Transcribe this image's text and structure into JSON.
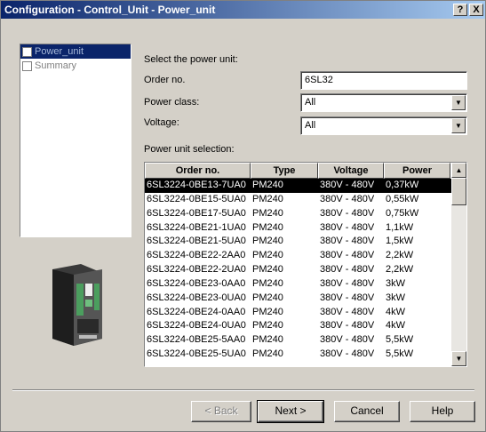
{
  "window": {
    "title": "Configuration - Control_Unit - Power_unit",
    "help_btn": "?",
    "close_btn": "X"
  },
  "tree": {
    "items": [
      {
        "label": "Power_unit",
        "selected": true
      },
      {
        "label": "Summary",
        "selected": false
      }
    ]
  },
  "form": {
    "heading": "Select the power unit:",
    "order_no": {
      "label": "Order no.",
      "value": "6SL32"
    },
    "power_class": {
      "label": "Power class:",
      "value": "All"
    },
    "voltage": {
      "label": "Voltage:",
      "value": "All"
    },
    "selection_label": "Power unit selection:"
  },
  "table": {
    "columns": [
      "Order no.",
      "Type",
      "Voltage",
      "Power"
    ],
    "rows": [
      [
        "6SL3224-0BE13-7UA0",
        "PM240",
        "380V - 480V",
        "0,37kW"
      ],
      [
        "6SL3224-0BE15-5UA0",
        "PM240",
        "380V - 480V",
        "0,55kW"
      ],
      [
        "6SL3224-0BE17-5UA0",
        "PM240",
        "380V - 480V",
        "0,75kW"
      ],
      [
        "6SL3224-0BE21-1UA0",
        "PM240",
        "380V - 480V",
        "1,1kW"
      ],
      [
        "6SL3224-0BE21-5UA0",
        "PM240",
        "380V - 480V",
        "1,5kW"
      ],
      [
        "6SL3224-0BE22-2AA0",
        "PM240",
        "380V - 480V",
        "2,2kW"
      ],
      [
        "6SL3224-0BE22-2UA0",
        "PM240",
        "380V - 480V",
        "2,2kW"
      ],
      [
        "6SL3224-0BE23-0AA0",
        "PM240",
        "380V - 480V",
        "3kW"
      ],
      [
        "6SL3224-0BE23-0UA0",
        "PM240",
        "380V - 480V",
        "3kW"
      ],
      [
        "6SL3224-0BE24-0AA0",
        "PM240",
        "380V - 480V",
        "4kW"
      ],
      [
        "6SL3224-0BE24-0UA0",
        "PM240",
        "380V - 480V",
        "4kW"
      ],
      [
        "6SL3224-0BE25-5AA0",
        "PM240",
        "380V - 480V",
        "5,5kW"
      ],
      [
        "6SL3224-0BE25-5UA0",
        "PM240",
        "380V - 480V",
        "5,5kW"
      ]
    ],
    "selected_row": 0
  },
  "buttons": {
    "back": "< Back",
    "next": "Next >",
    "cancel": "Cancel",
    "help": "Help"
  },
  "icons": {
    "scroll_up": "scroll-up-arrow",
    "scroll_down": "scroll-down-arrow",
    "combo": "dropdown-arrow"
  }
}
